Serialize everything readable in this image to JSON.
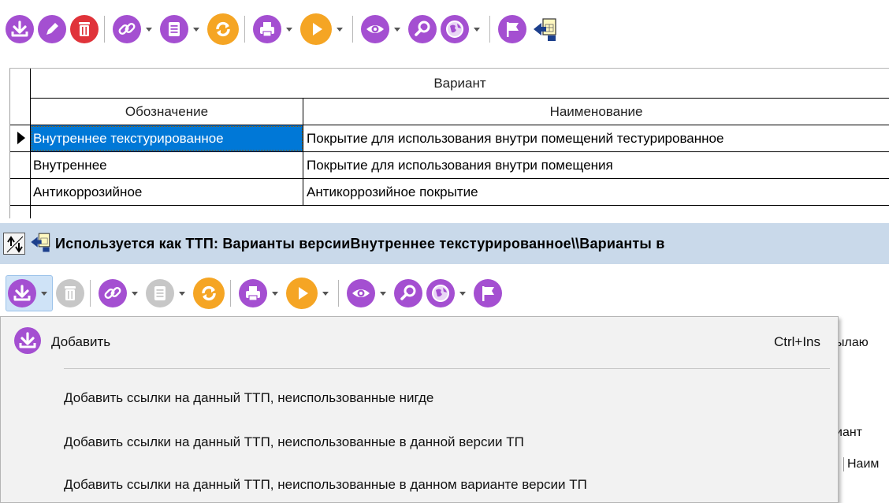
{
  "colors": {
    "purple": "#a44fd1",
    "red": "#e0333a",
    "orange": "#f5a524",
    "selection": "#0078d7",
    "panel_bar": "#c9d9ea",
    "menu_bg": "#f2f2f2"
  },
  "toolbar_top": {
    "icons": [
      "add-icon",
      "edit-icon",
      "delete-icon",
      "link-icon",
      "list-icon",
      "refresh-icon",
      "print-icon",
      "play-icon",
      "view-icon",
      "search-icon",
      "globe-icon",
      "flag-icon",
      "export-table-icon"
    ]
  },
  "grid": {
    "group_header": "Вариант",
    "columns": [
      "Обозначение",
      "Наименование"
    ],
    "rows": [
      {
        "code": "Внутреннее текстурированное",
        "name": "Покрытие для использования внутри помещений тестурированное"
      },
      {
        "code": "Внутреннее",
        "name": "Покрытие для использования внутри помещения"
      },
      {
        "code": "Антикоррозийное",
        "name": "Антикоррозийное покрытие"
      }
    ]
  },
  "panel": {
    "title": "Используется как ТТП: Варианты версииВнутреннее текстурированное\\\\Варианты в"
  },
  "toolbar_bottom": {
    "icons": [
      "add-icon",
      "delete-icon",
      "link-icon",
      "list-icon",
      "refresh-icon",
      "print-icon",
      "play-icon",
      "view-icon",
      "search-icon",
      "globe-icon",
      "flag-icon"
    ]
  },
  "peek": {
    "text1": "ылаю",
    "text2": "иант",
    "text3": "Наим"
  },
  "menu": {
    "items": [
      {
        "label": "Добавить",
        "shortcut": "Ctrl+Ins"
      },
      {
        "label": "Добавить ссылки на данный ТТП, неиспользованные нигде"
      },
      {
        "label": "Добавить ссылки на данный ТТП, неиспользованные в данной версии ТП"
      },
      {
        "label": "Добавить ссылки на данный ТТП, неиспользованные в данном варианте версии ТП"
      }
    ]
  }
}
